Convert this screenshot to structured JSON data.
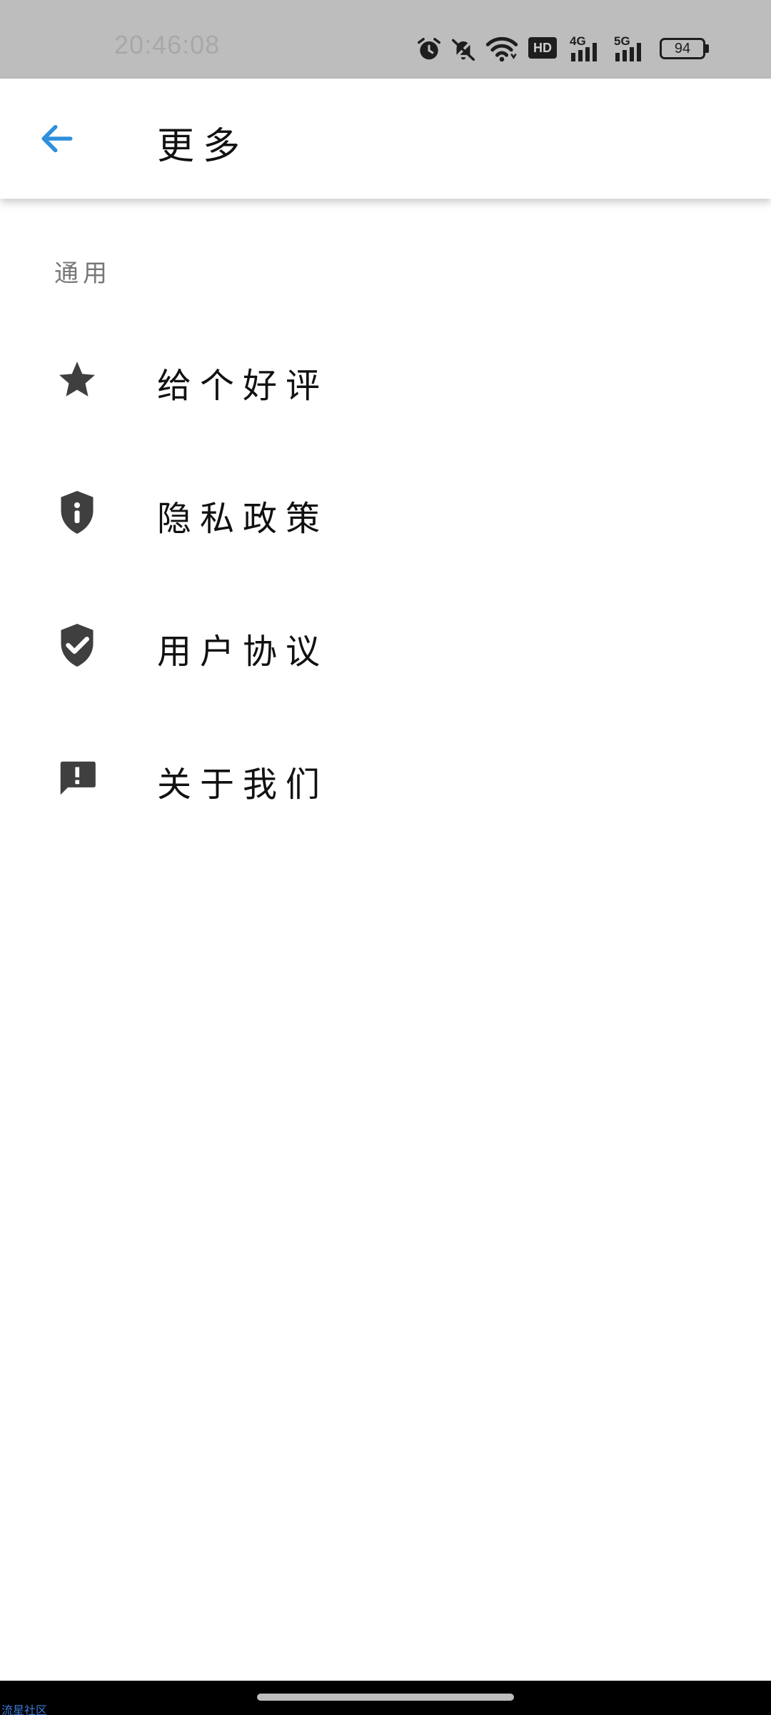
{
  "status_bar": {
    "time": "20:46:08",
    "hd_label": "HD",
    "net_4g": "4G",
    "net_5g": "5G",
    "battery": "94",
    "icons": [
      "alarm-icon",
      "mute-icon",
      "wifi-icon",
      "hd-icon",
      "signal-4g-icon",
      "signal-5g-icon",
      "battery-icon"
    ]
  },
  "app_bar": {
    "title": "更多",
    "back_icon": "arrow-left-icon",
    "accent_color": "#2e8fdc"
  },
  "section": {
    "header": "通用",
    "items": [
      {
        "label": "给个好评",
        "icon": "star-icon"
      },
      {
        "label": "隐私政策",
        "icon": "shield-info-icon"
      },
      {
        "label": "用户协议",
        "icon": "shield-check-icon"
      },
      {
        "label": "关于我们",
        "icon": "feedback-icon"
      }
    ]
  },
  "footer": {
    "watermark": "流星社区"
  },
  "colors": {
    "icon": "#3f3f3f",
    "status_bar_bg": "#bdbdbd",
    "nav_bar_bg": "#000000"
  }
}
